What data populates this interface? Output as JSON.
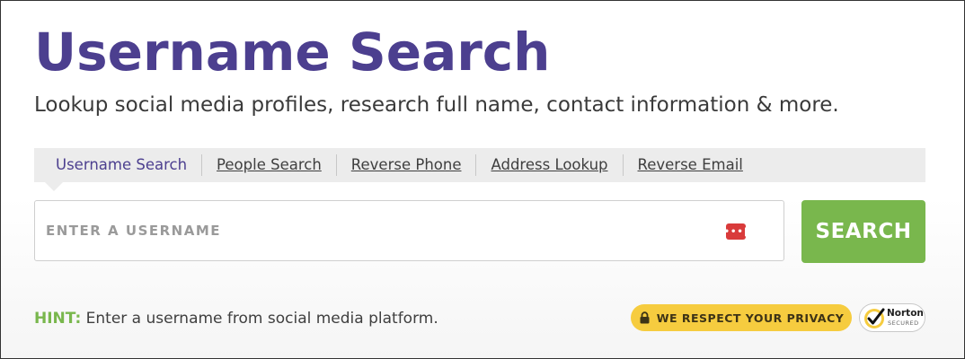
{
  "header": {
    "title": "Username Search",
    "subtitle": "Lookup social media profiles, research full name, contact information & more."
  },
  "tabs": [
    {
      "label": "Username Search",
      "active": true
    },
    {
      "label": "People Search",
      "active": false
    },
    {
      "label": "Reverse Phone",
      "active": false
    },
    {
      "label": "Address Lookup",
      "active": false
    },
    {
      "label": "Reverse Email",
      "active": false
    }
  ],
  "search": {
    "placeholder": "ENTER A USERNAME",
    "value": "",
    "button_label": "SEARCH",
    "password_manager_icon": "password-dots-icon"
  },
  "hint": {
    "label": "HINT:",
    "text": " Enter a username from social media platform."
  },
  "badges": {
    "privacy": "WE RESPECT YOUR PRIVACY",
    "norton_name": "Norton",
    "norton_sub": "SECURED"
  },
  "colors": {
    "title": "#4c3f8f",
    "accent_green": "#79b74d",
    "privacy_yellow": "#f6cc3f",
    "tab_bar": "#ececec",
    "password_icon_red": "#d93b3b"
  }
}
